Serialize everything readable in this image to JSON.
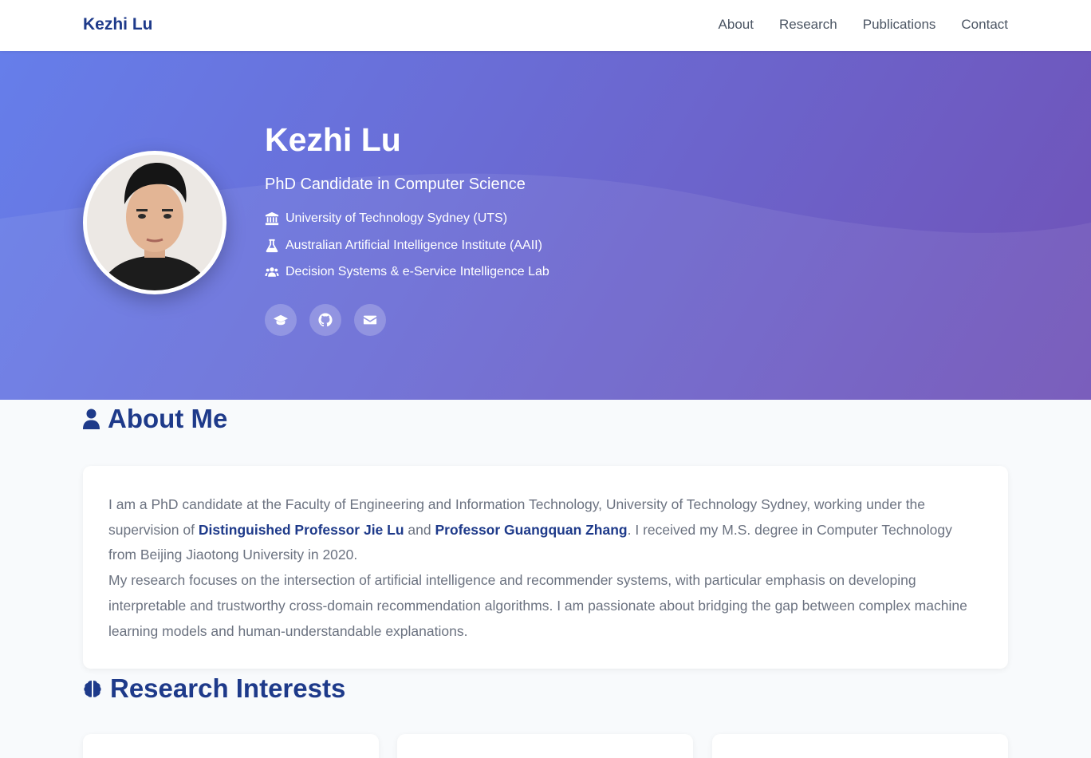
{
  "nav": {
    "brand": "Kezhi Lu",
    "links": [
      "About",
      "Research",
      "Publications",
      "Contact"
    ]
  },
  "hero": {
    "name": "Kezhi Lu",
    "title": "PhD Candidate in Computer Science",
    "affiliations": [
      {
        "icon": "university-icon",
        "text": "University of Technology Sydney (UTS)"
      },
      {
        "icon": "flask-icon",
        "text": "Australian Artificial Intelligence Institute (AAII)"
      },
      {
        "icon": "users-icon",
        "text": "Decision Systems & e-Service Intelligence Lab"
      }
    ],
    "social_icons": [
      "graduation-cap-icon",
      "github-icon",
      "envelope-icon"
    ]
  },
  "about": {
    "heading": "About Me",
    "p1_a": "I am a PhD candidate at the Faculty of Engineering and Information Technology, University of Technology Sydney, working under the supervision of ",
    "supervisor1": "Distinguished Professor Jie Lu",
    "p1_b": " and ",
    "supervisor2": "Professor Guangquan Zhang",
    "p1_c": ". I received my M.S. degree in Computer Technology from Beijing Jiaotong University in 2020.",
    "p2": "My research focuses on the intersection of artificial intelligence and recommender systems, with particular emphasis on developing interpretable and trustworthy cross-domain recommendation algorithms. I am passionate about bridging the gap between complex machine learning models and human-understandable explanations."
  },
  "research": {
    "heading": "Research Interests"
  },
  "colors": {
    "accent": "#1e3a8a",
    "hero_start": "#667eea",
    "hero_end": "#7052b7",
    "body_text": "#6b7280"
  }
}
